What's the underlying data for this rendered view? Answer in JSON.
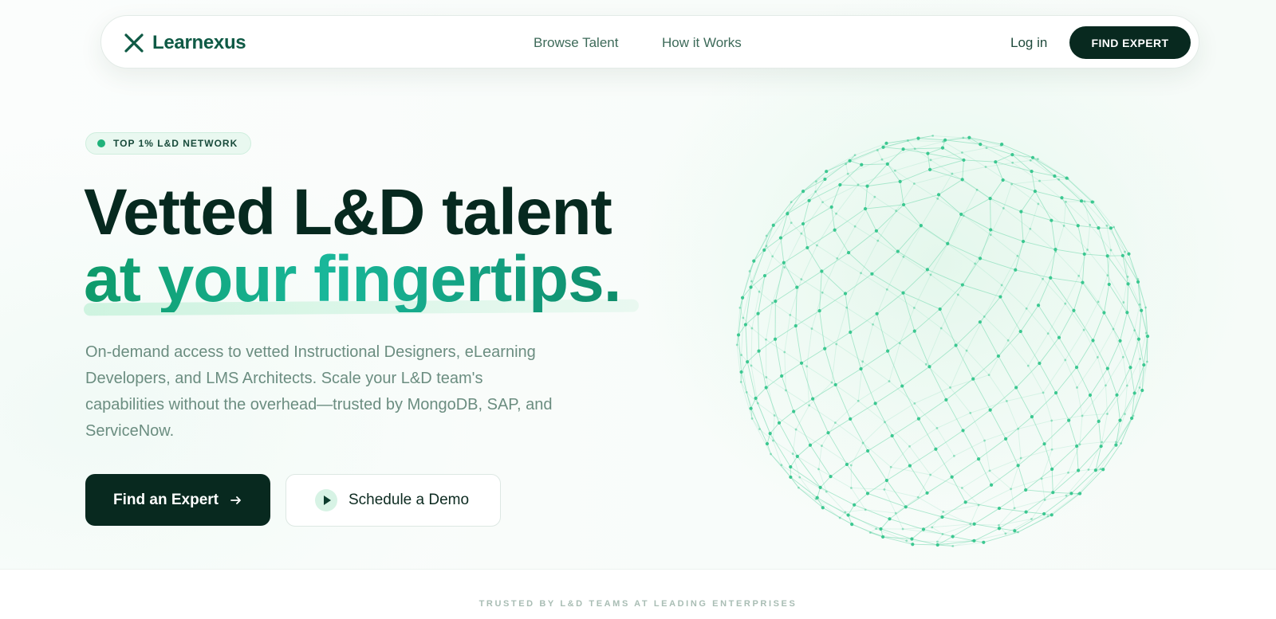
{
  "nav": {
    "brand": "Learnexus",
    "links": [
      "Browse Talent",
      "How it Works"
    ],
    "login": "Log in",
    "cta": "FIND EXPERT"
  },
  "hero": {
    "badge": "TOP 1% L&D NETWORK",
    "headline_line1": "Vetted L&D talent",
    "headline_line2": "at your fingertips.",
    "subtext": "On-demand access to vetted Instructional Designers, eLearning Developers, and LMS Architects. Scale your L&D team's capabilities without the overhead—trusted by MongoDB, SAP, and ServiceNow.",
    "primary_button": "Find an Expert",
    "secondary_button": "Schedule a Demo"
  },
  "trusted": {
    "label": "TRUSTED BY L&D TEAMS AT LEADING ENTERPRISES"
  },
  "colors": {
    "brand_dark": "#08291f",
    "brand_green": "#0f5a45",
    "accent": "#19b79a",
    "globe_node": "#34c58c",
    "globe_line": "#8fe0bd"
  },
  "icons": {
    "logo": "x-mark-logo-icon",
    "arrow": "arrow-right-icon",
    "play": "play-icon",
    "badge_dot": "status-dot-icon"
  }
}
